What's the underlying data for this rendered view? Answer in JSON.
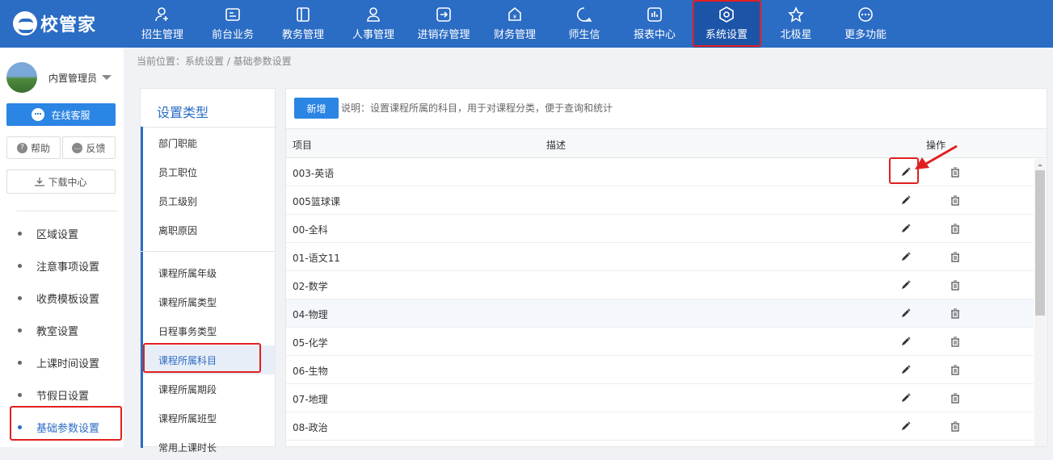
{
  "brand": {
    "name": "校管家"
  },
  "nav": {
    "items": [
      {
        "label": "招生管理",
        "icon": "user-add-icon"
      },
      {
        "label": "前台业务",
        "icon": "front-desk-icon"
      },
      {
        "label": "教务管理",
        "icon": "book-icon"
      },
      {
        "label": "人事管理",
        "icon": "person-icon"
      },
      {
        "label": "进销存管理",
        "icon": "inventory-icon"
      },
      {
        "label": "财务管理",
        "icon": "yen-icon"
      },
      {
        "label": "师生信",
        "icon": "message-icon"
      },
      {
        "label": "报表中心",
        "icon": "report-icon"
      },
      {
        "label": "系统设置",
        "icon": "settings-icon",
        "active": true
      },
      {
        "label": "北极星",
        "icon": "star-icon"
      },
      {
        "label": "更多功能",
        "icon": "more-icon"
      }
    ]
  },
  "sidebar": {
    "user_name": "内置管理员",
    "online_service": "在线客服",
    "help": "帮助",
    "feedback": "反馈",
    "download_center": "下载中心",
    "menu": [
      {
        "label": "区域设置"
      },
      {
        "label": "注意事项设置"
      },
      {
        "label": "收费模板设置"
      },
      {
        "label": "教室设置"
      },
      {
        "label": "上课时间设置"
      },
      {
        "label": "节假日设置"
      },
      {
        "label": "基础参数设置",
        "active": true
      }
    ]
  },
  "breadcrumb": "当前位置：系统设置 / 基础参数设置",
  "type_panel": {
    "title": "设置类型",
    "group1": [
      "部门职能",
      "员工职位",
      "员工级别",
      "离职原因"
    ],
    "group2": [
      "课程所属年级",
      "课程所属类型",
      "日程事务类型",
      "课程所属科目",
      "课程所属期段",
      "课程所属班型",
      "常用上课时长"
    ],
    "active": "课程所属科目"
  },
  "main": {
    "add_label": "新增",
    "note": "说明：设置课程所属的科目，用于对课程分类，便于查询和统计",
    "columns": {
      "item": "项目",
      "desc": "描述",
      "ops": "操作"
    },
    "rows": [
      "003-英语",
      "005篮球课",
      "00-全科",
      "01-语文11",
      "02-数学",
      "04-物理",
      "05-化学",
      "06-生物",
      "07-地理",
      "08-政治"
    ],
    "highlighted_row": "04-物理"
  },
  "colors": {
    "primary": "#2b6cc4",
    "button": "#2b85e4",
    "annotation": "#e02020"
  }
}
